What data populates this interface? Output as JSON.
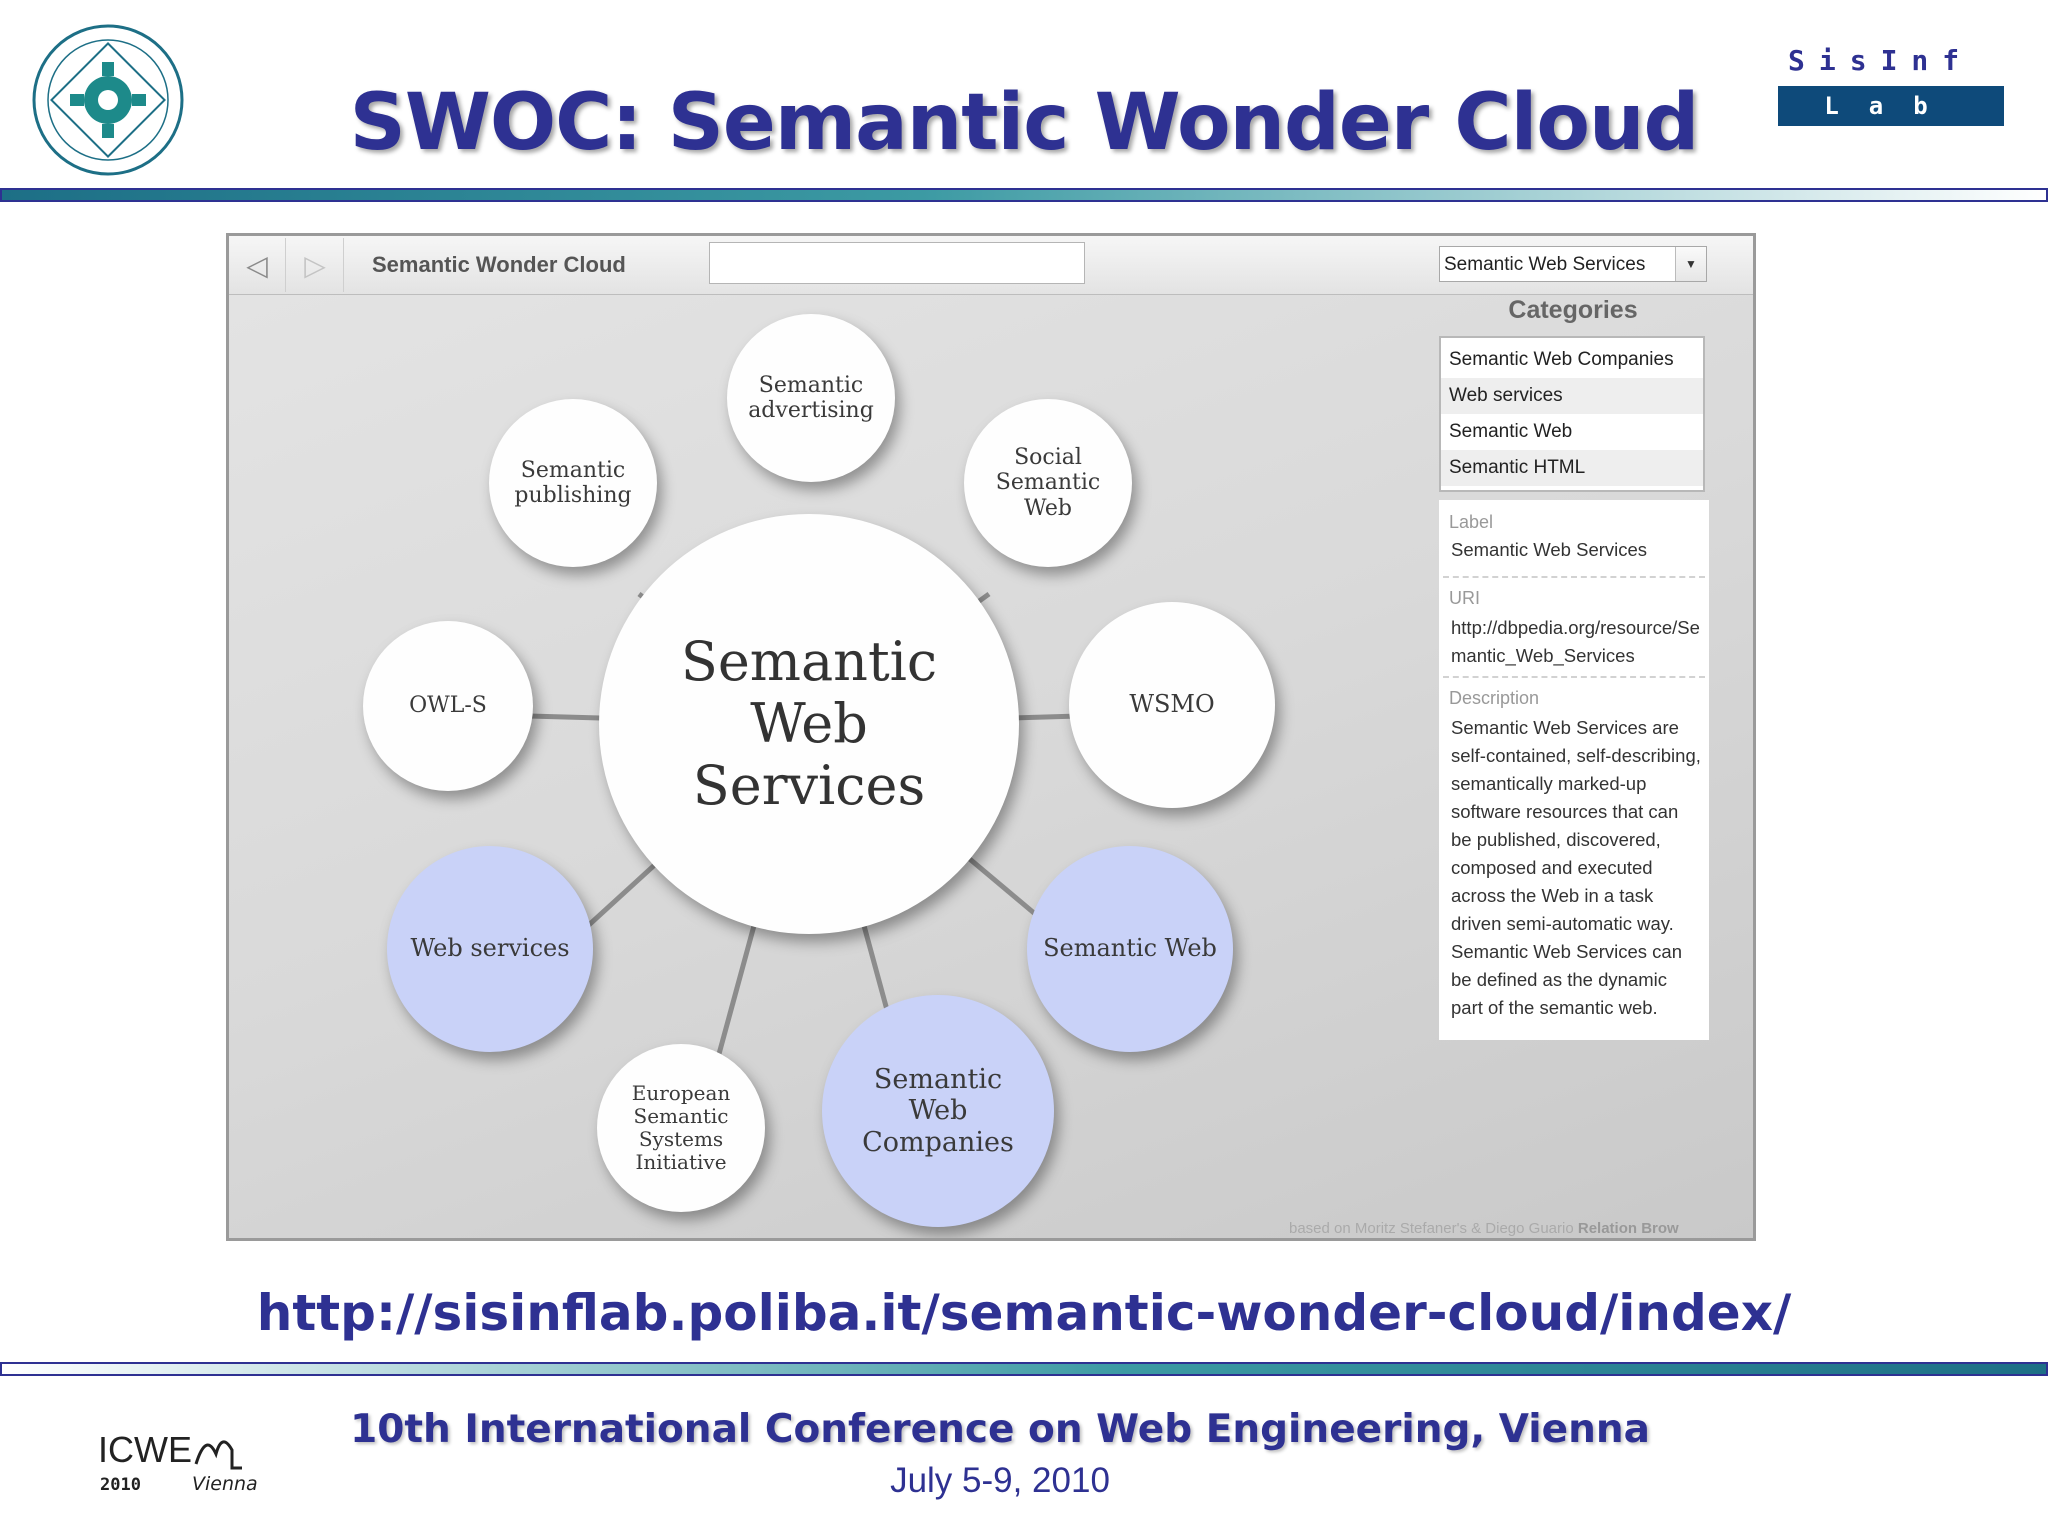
{
  "slide": {
    "title": "SWOC: Semantic Wonder Cloud",
    "url": "http://sisinflab.poliba.it/semantic-wonder-cloud/index/",
    "conference": "10th International Conference on Web Engineering, Vienna",
    "dates": "July 5-9, 2010"
  },
  "logos": {
    "right_line1": "SisInf",
    "right_line2": "Lab",
    "icwe_text": "ICWE",
    "icwe_year": "2010",
    "icwe_city": "Vienna"
  },
  "app": {
    "title": "Semantic Wonder Cloud",
    "search_value": "",
    "selected_category": "Semantic Web Services",
    "categories_title": "Categories",
    "categories": [
      "Semantic Web Companies",
      "Web services",
      "Semantic Web",
      "Semantic HTML"
    ],
    "info": {
      "label_title": "Label",
      "label_value": "Semantic Web Services",
      "uri_title": "URI",
      "uri_value": "http://dbpedia.org/resource/Semantic_Web_Services",
      "description_title": "Description",
      "description_value": "Semantic Web Services are self-contained, self-describing, semantically marked-up software resources that can be published, discovered, composed and executed across the Web in a task driven semi-automatic way. Semantic Web Services can be defined as the dynamic part of the semantic web."
    },
    "credit_prefix": "based on Moritz Stefaner's & Diego Guario",
    "credit_bold": "Relation Brow",
    "graph": {
      "center": "Semantic Web Services",
      "nodes": [
        {
          "label": "Semantic advertising",
          "highlight": false
        },
        {
          "label": "Semantic publishing",
          "highlight": false
        },
        {
          "label": "Social Semantic Web",
          "highlight": false
        },
        {
          "label": "OWL-S",
          "highlight": false
        },
        {
          "label": "WSMO",
          "highlight": false
        },
        {
          "label": "Web services",
          "highlight": true
        },
        {
          "label": "Semantic Web",
          "highlight": true
        },
        {
          "label": "European Semantic Systems Initiative",
          "highlight": false
        },
        {
          "label": "Semantic Web Companies",
          "highlight": true
        }
      ]
    }
  },
  "colors": {
    "title_blue": "#2e3192",
    "highlight_node": "#c9d2f8",
    "teal_rule": "#1d6f86"
  }
}
